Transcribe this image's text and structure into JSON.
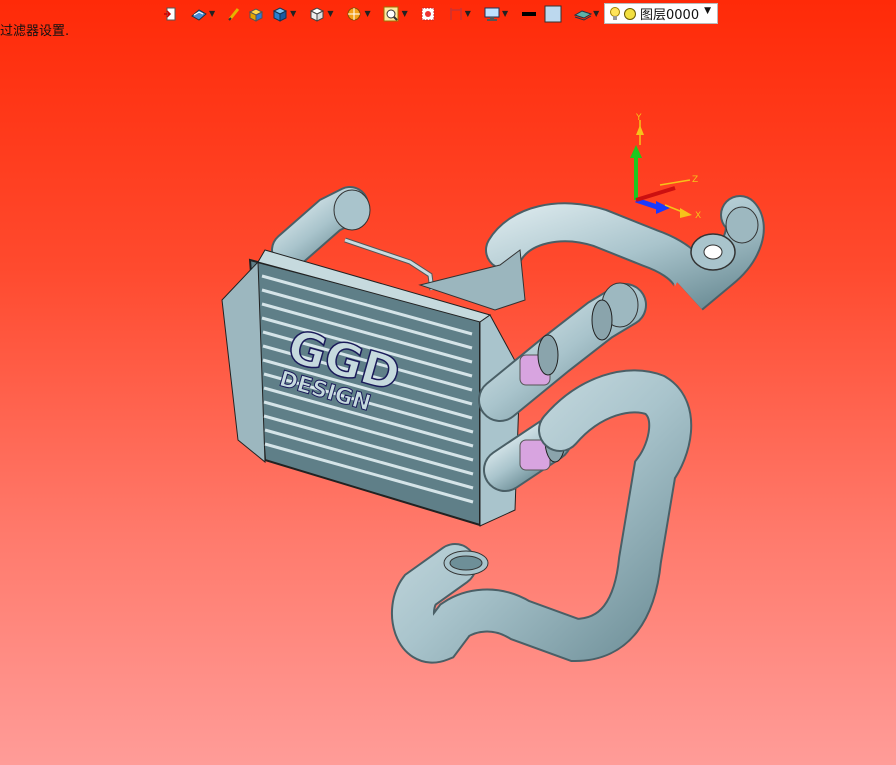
{
  "status": {
    "text": "过滤器设置."
  },
  "toolbar": {
    "buttons": [
      {
        "icon": "exit-sketch-icon"
      },
      {
        "icon": "view-orient-icon"
      },
      {
        "icon": "pen-icon"
      },
      {
        "icon": "shaded-box-icon"
      },
      {
        "icon": "blue-cube-icon"
      },
      {
        "icon": "white-cube-icon"
      },
      {
        "icon": "render-sphere-icon"
      },
      {
        "icon": "zoom-fit-icon"
      },
      {
        "icon": "zoom-area-icon"
      },
      {
        "icon": "dimension-icon"
      },
      {
        "icon": "display-monitor-icon"
      },
      {
        "icon": "black-line-color-icon"
      },
      {
        "icon": "face-color-swatch-icon"
      },
      {
        "icon": "layer-plane-icon"
      }
    ]
  },
  "layer": {
    "name": "图层0000"
  },
  "colors": {
    "bg_top": "#ff2a08",
    "bg_bottom": "#ff9c98",
    "part": "#a9c4cc",
    "part_dark": "#5f7f88",
    "coupler": "#d8a4e0"
  },
  "model": {
    "logo_line1": "GGD",
    "logo_line2": "DESIGN"
  },
  "triad": {
    "x_label": "X",
    "y_label": "Y",
    "z_label": "Z"
  }
}
